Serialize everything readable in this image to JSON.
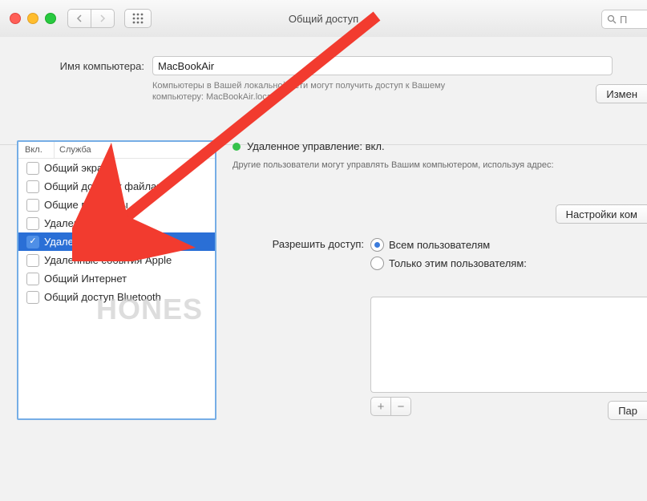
{
  "window": {
    "title": "Общий доступ"
  },
  "toolbar": {
    "search_prefix": "П"
  },
  "name_row": {
    "label": "Имя компьютера:",
    "value": "MacBookAir",
    "sub_line1": "Компьютеры в Вашей локальной сети могут получить доступ к Вашему",
    "sub_line2": "компьютеру: MacBookAir.local",
    "edit_btn": "Измен"
  },
  "services": {
    "col_on": "Вкл.",
    "col_service": "Служба",
    "items": [
      {
        "label": "Общий экран",
        "checked": false,
        "selected": false
      },
      {
        "label": "Общий доступ к файлам",
        "checked": false,
        "selected": false
      },
      {
        "label": "Общие принтеры",
        "checked": false,
        "selected": false
      },
      {
        "label": "Удаленный вход",
        "checked": false,
        "selected": false
      },
      {
        "label": "Удаленное управление",
        "checked": true,
        "selected": true
      },
      {
        "label": "Удаленные события Apple",
        "checked": false,
        "selected": false
      },
      {
        "label": "Общий Интернет",
        "checked": false,
        "selected": false
      },
      {
        "label": "Общий доступ Bluetooth",
        "checked": false,
        "selected": false
      }
    ]
  },
  "detail": {
    "status_title": "Удаленное управление: вкл.",
    "status_sub": "Другие пользователи могут управлять Вашим компьютером, используя адрес:",
    "settings_btn": "Настройки ком",
    "allow_label": "Разрешить доступ:",
    "radio_all": "Всем пользователям",
    "radio_only": "Только этим пользователям:",
    "params_btn": "Пар"
  },
  "watermark": "HONES"
}
